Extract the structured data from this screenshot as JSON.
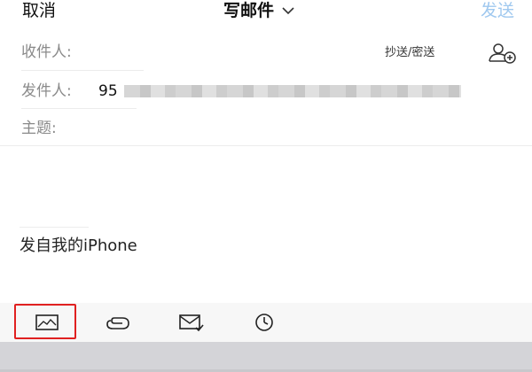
{
  "header": {
    "cancel_label": "取消",
    "title": "写邮件",
    "send_label": "发送"
  },
  "fields": {
    "recipient_label": "收件人:",
    "cc_bcc_label": "抄送/密送",
    "sender_label": "发件人:",
    "sender_value_visible": "95",
    "subject_label": "主题:"
  },
  "body": {
    "signature": "发自我的iPhone"
  },
  "toolbar": {
    "items": [
      "image-icon",
      "attachment-icon",
      "mail-icon",
      "clock-icon"
    ],
    "highlight_color": "#e02020"
  },
  "colors": {
    "send_disabled": "#9fc8ef",
    "label_gray": "#8a8a8a"
  }
}
